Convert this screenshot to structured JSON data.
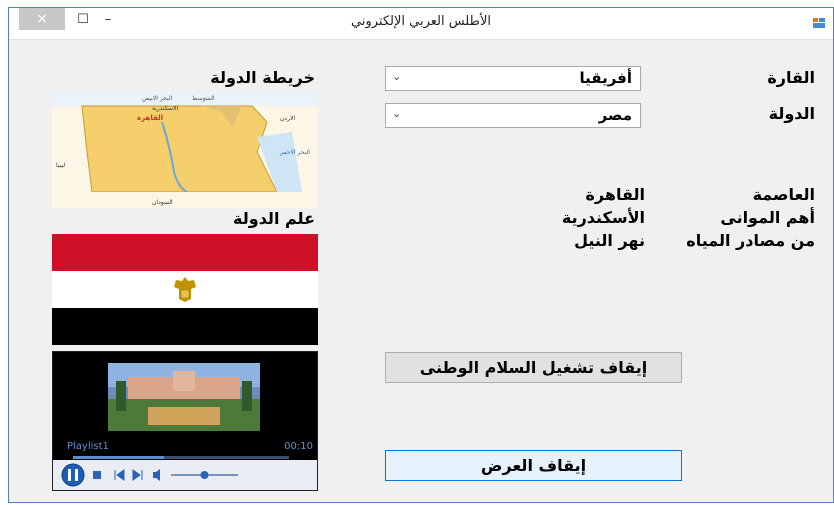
{
  "window": {
    "title": "الأطلس العربي الإلكتروني",
    "close_glyph": "×",
    "maximize_glyph": "☐",
    "minimize_glyph": "–"
  },
  "labels": {
    "continent": "القارة",
    "country": "الدولة",
    "country_map": "خريطة الدولة",
    "country_flag": "علم الدولة",
    "capital": "العاصمة",
    "main_ports": "أهم الموانى",
    "water_sources": "من مصادر المياه"
  },
  "fields": {
    "continent_selected": "أفريقيا",
    "country_selected": "مصر"
  },
  "values": {
    "capital": "القاهرة",
    "main_port": "الأسكندرية",
    "water_source": "نهر النيل"
  },
  "buttons": {
    "stop_anthem": "إيقاف تشغيل السلام الوطنى",
    "stop_show": "إيقاف العرض"
  },
  "player": {
    "playlist": "Playlist1",
    "time": "00:10",
    "progress": 0.42,
    "volume": 0.5
  },
  "map_labels": {
    "sea": "البحر الابيض",
    "sea2": "المتوسط",
    "cairo": "القاهرة",
    "alex": "الاسكندرية",
    "jordan": "الاردن",
    "libya": "ليبيا",
    "red_sea": "البحر الاحمر",
    "sudan": "السودان"
  },
  "colors": {
    "flag_red": "#ce1126",
    "flag_white": "#ffffff",
    "flag_black": "#000000",
    "emblem_gold": "#c09300"
  }
}
